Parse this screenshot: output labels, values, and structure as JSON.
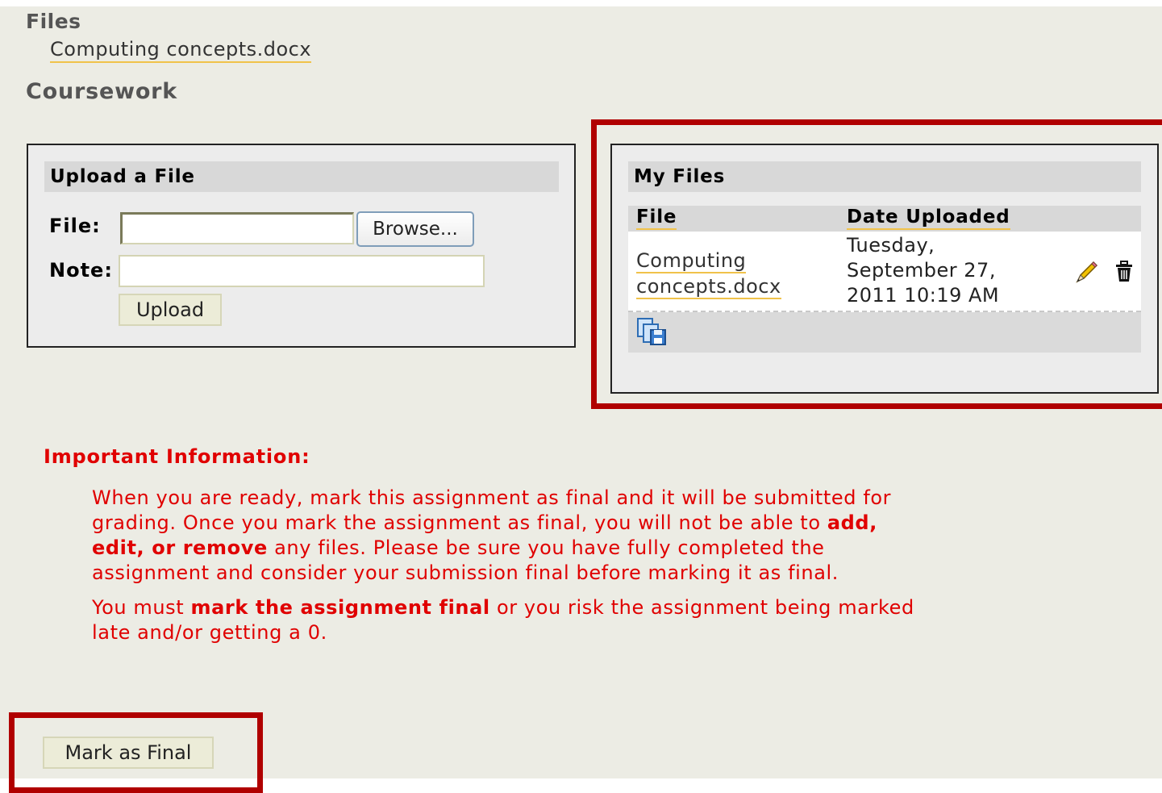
{
  "files": {
    "heading": "Files",
    "items": [
      {
        "name": "Computing concepts.docx"
      }
    ]
  },
  "coursework": {
    "heading": "Coursework"
  },
  "upload": {
    "title": "Upload a File",
    "file_label": "File:",
    "file_value": "",
    "browse_label": "Browse...",
    "note_label": "Note:",
    "note_value": "",
    "upload_label": "Upload"
  },
  "my_files": {
    "title": "My Files",
    "columns": [
      "File",
      "Date Uploaded"
    ],
    "rows": [
      {
        "file_line1": "Computing",
        "file_line2": "concepts.docx",
        "date_line1": "Tuesday,",
        "date_line2": "September 27,",
        "date_line3": "2011 10:19 AM",
        "actions": [
          "pencil-icon",
          "trash-icon"
        ]
      }
    ],
    "footer_icon": "copy-save-icon"
  },
  "important": {
    "title": "Important Information:",
    "para1": {
      "text_a": "When you are ready, mark this assignment as final and it will be submitted for grading. Once you mark the assignment as final, you will not be able to ",
      "bold": "add, edit, or remove",
      "text_b": " any files. Please be sure you have fully completed the assignment and consider your submission final before marking it as final."
    },
    "para2": {
      "text_a": "You must ",
      "bold": "mark the assignment final",
      "text_b": " or you risk the assignment being marked late and/or getting a 0."
    }
  },
  "actions": {
    "mark_final_label": "Mark as Final"
  },
  "colors": {
    "page_bg": "#ecece4",
    "highlight_border": "#b00000",
    "warning_text": "#e00000",
    "link_underline": "#f0c24a"
  }
}
